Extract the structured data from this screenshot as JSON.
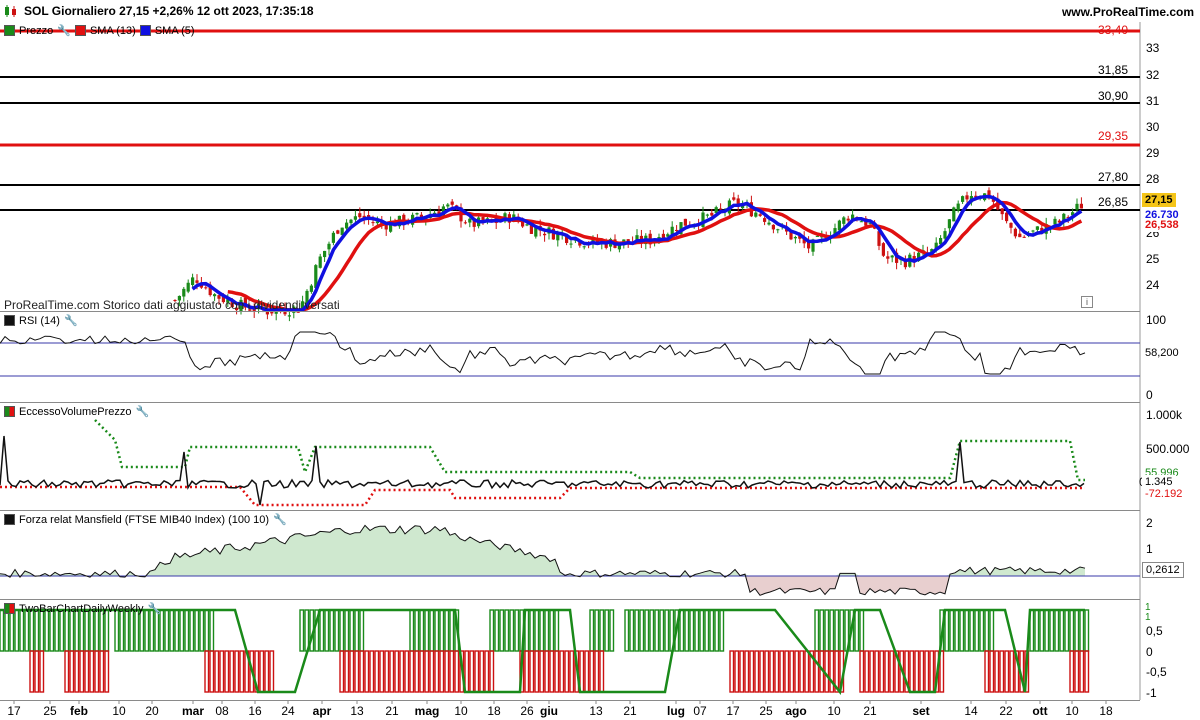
{
  "header": {
    "title": "SOL Giornaliero 27,15 +2,26% 12 ott 2023, 17:35:18",
    "site": "www.ProRealTime.com"
  },
  "price_panel": {
    "legend": [
      {
        "label": "Prezzo",
        "color": "#1a8a1a"
      },
      {
        "label": "SMA (13)",
        "color": "#e01010"
      },
      {
        "label": "SMA (5)",
        "color": "#1010e0"
      }
    ],
    "levels": [
      {
        "label": "33,40",
        "color": "#e01010"
      },
      {
        "label": "31,85",
        "color": "#000000"
      },
      {
        "label": "30,90",
        "color": "#000000"
      },
      {
        "label": "29,35",
        "color": "#e01010"
      },
      {
        "label": "27,80",
        "color": "#000000"
      },
      {
        "label": "26,85",
        "color": "#000000"
      }
    ],
    "yticks": [
      "33",
      "32",
      "31",
      "30",
      "29",
      "28",
      "26",
      "25",
      "24"
    ],
    "last_price": "27,15",
    "sma5_value": "26,730",
    "sma13_value": "26,538",
    "watermark": "ProRealTime.com  Storico dati aggiustato con i dividendi versati"
  },
  "rsi_panel": {
    "label": "RSI (14)",
    "value": "58,200",
    "yticks": [
      "100",
      "0"
    ]
  },
  "volume_panel": {
    "label": "EccessoVolumePrezzo",
    "values": [
      "55.996",
      "1.345",
      "-72.192"
    ],
    "yticks": [
      "1.000k",
      "500.000",
      "0"
    ]
  },
  "mansfield_panel": {
    "label": "Forza relat Mansfield (FTSE MIB40 Index) (100 10)",
    "value": "0,2612",
    "yticks": [
      "2",
      "1"
    ]
  },
  "twobar_panel": {
    "label": "TwoBarChartDailyWeekly",
    "values": [
      "1",
      "1"
    ],
    "yticks": [
      "0,5",
      "0",
      "-0,5",
      "-1"
    ]
  },
  "xaxis": [
    {
      "label": "17",
      "bold": false
    },
    {
      "label": "25",
      "bold": false
    },
    {
      "label": "feb",
      "bold": true
    },
    {
      "label": "10",
      "bold": false
    },
    {
      "label": "20",
      "bold": false
    },
    {
      "label": "mar",
      "bold": true
    },
    {
      "label": "08",
      "bold": false
    },
    {
      "label": "16",
      "bold": false
    },
    {
      "label": "24",
      "bold": false
    },
    {
      "label": "apr",
      "bold": true
    },
    {
      "label": "13",
      "bold": false
    },
    {
      "label": "21",
      "bold": false
    },
    {
      "label": "mag",
      "bold": true
    },
    {
      "label": "10",
      "bold": false
    },
    {
      "label": "18",
      "bold": false
    },
    {
      "label": "26",
      "bold": false
    },
    {
      "label": "giu",
      "bold": true
    },
    {
      "label": "13",
      "bold": false
    },
    {
      "label": "21",
      "bold": false
    },
    {
      "label": "lug",
      "bold": true
    },
    {
      "label": "07",
      "bold": false
    },
    {
      "label": "17",
      "bold": false
    },
    {
      "label": "25",
      "bold": false
    },
    {
      "label": "ago",
      "bold": true
    },
    {
      "label": "10",
      "bold": false
    },
    {
      "label": "21",
      "bold": false
    },
    {
      "label": "set",
      "bold": true
    },
    {
      "label": "14",
      "bold": false
    },
    {
      "label": "22",
      "bold": false
    },
    {
      "label": "ott",
      "bold": true
    },
    {
      "label": "10",
      "bold": false
    },
    {
      "label": "18",
      "bold": false
    }
  ],
  "colors": {
    "up": "#1a8a1a",
    "down": "#cc1111",
    "sma5": "#1010e0",
    "sma13": "#e01010",
    "pos_fill": "#cfe8cf",
    "neg_fill": "#e8cfcf"
  }
}
